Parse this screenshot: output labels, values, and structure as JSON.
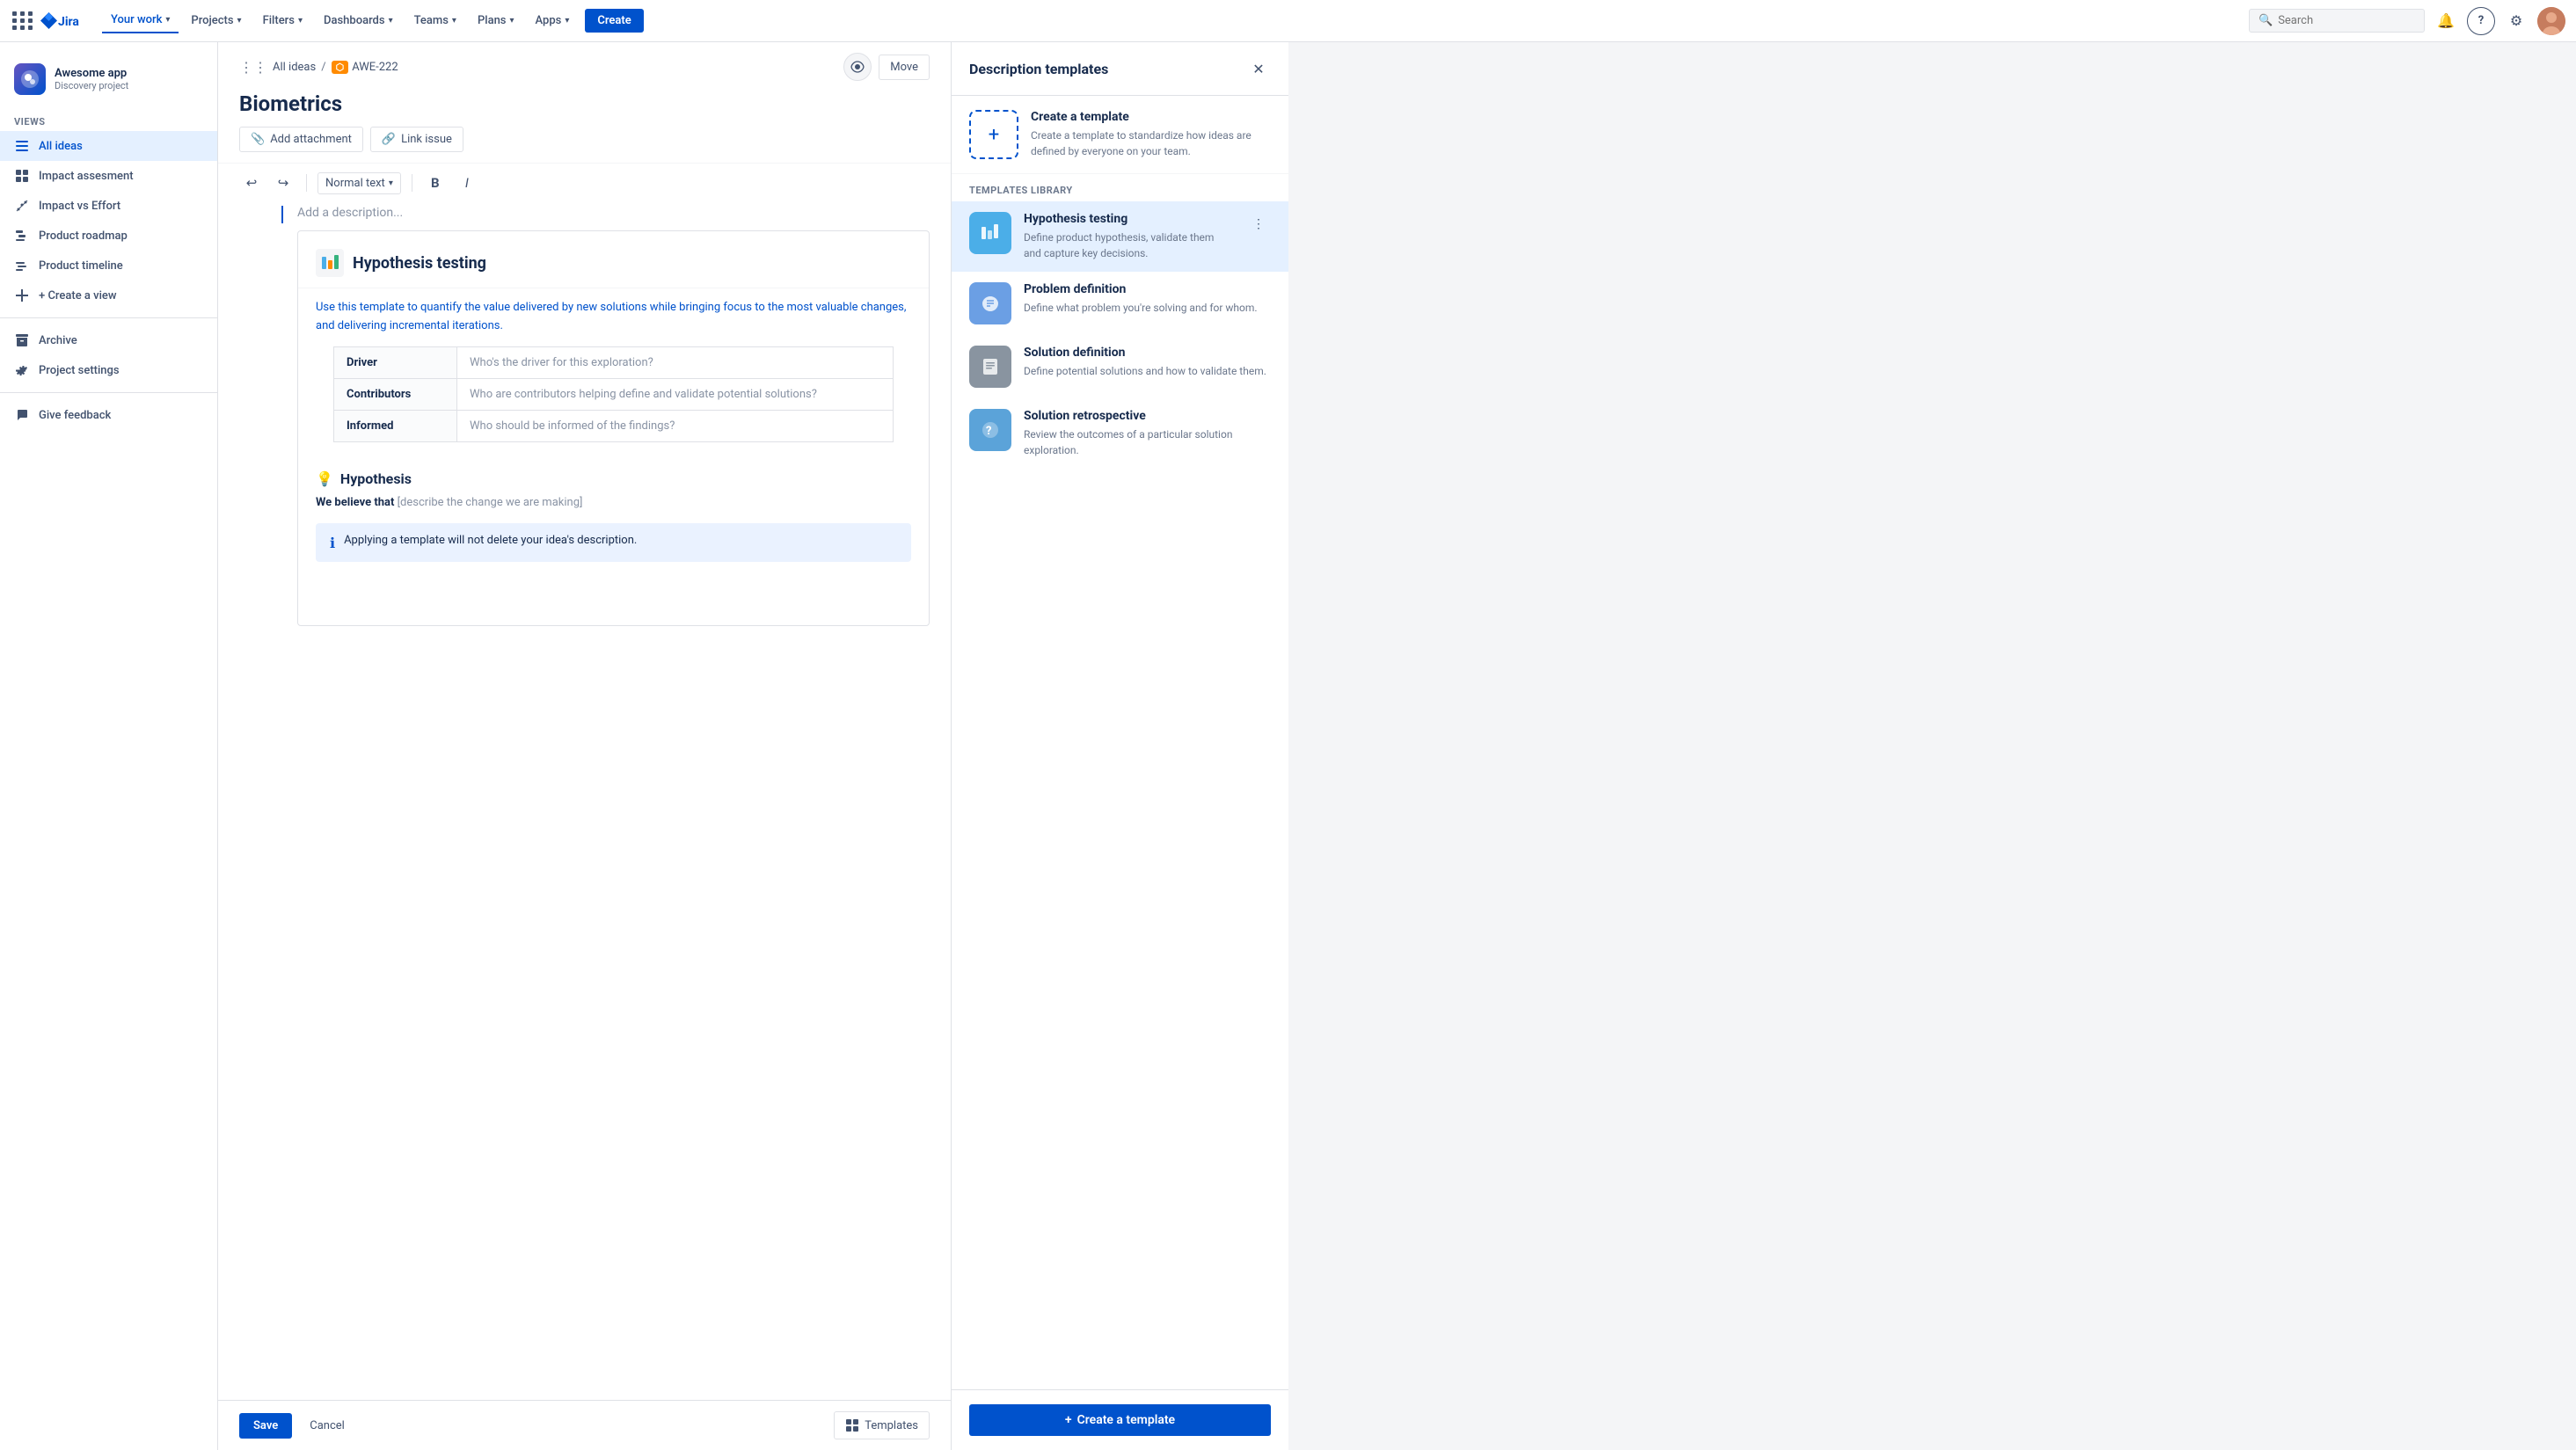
{
  "nav": {
    "your_work": "Your work",
    "projects": "Projects",
    "filters": "Filters",
    "dashboards": "Dashboards",
    "teams": "Teams",
    "plans": "Plans",
    "apps": "Apps",
    "create": "Create",
    "search_placeholder": "Search"
  },
  "sidebar": {
    "project_name": "Awesome app",
    "project_type": "Discovery project",
    "views_label": "VIEWS",
    "add_view": "+ Create a view",
    "items": [
      {
        "id": "all-ideas",
        "label": "All ideas",
        "icon": "list-icon",
        "active": true
      },
      {
        "id": "impact-assessment",
        "label": "Impact assesment",
        "icon": "table-icon"
      },
      {
        "id": "impact-vs-effort",
        "label": "Impact vs Effort",
        "icon": "chart-icon"
      },
      {
        "id": "product-roadmap",
        "label": "Product roadmap",
        "icon": "grid-icon"
      },
      {
        "id": "product-timeline",
        "label": "Product timeline",
        "icon": "timeline-icon"
      }
    ],
    "archive": "Archive",
    "project_settings": "Project settings",
    "give_feedback": "Give feedback"
  },
  "breadcrumb": {
    "all_ideas": "All ideas",
    "issue_id": "AWE-222",
    "watch_label": "Watch",
    "move_label": "Move"
  },
  "issue": {
    "title": "Biometrics",
    "add_attachment": "Add attachment",
    "link_issue": "Link issue",
    "description_placeholder": "Add a description...",
    "text_style": "Normal text"
  },
  "toolbar": {
    "save": "Save",
    "cancel": "Cancel",
    "templates": "Templates"
  },
  "template_preview": {
    "title": "Hypothesis testing",
    "description": "Use this template to quantify the value delivered by new solutions while bringing focus to the most valuable changes, and delivering incremental iterations.",
    "table_rows": [
      {
        "label": "Driver",
        "placeholder": "Who's the driver for this exploration?"
      },
      {
        "label": "Contributors",
        "placeholder": "Who are contributors helping define and validate potential solutions?"
      },
      {
        "label": "Informed",
        "placeholder": "Who should be informed of the findings?"
      }
    ],
    "hypothesis_title": "Hypothesis",
    "hypothesis_text_strong": "We believe that",
    "hypothesis_text_rest": " [describe the change we are making]",
    "notice": "Applying a template will not delete your idea's description."
  },
  "right_panel": {
    "title": "Description templates",
    "create_template_title": "Create a template",
    "create_template_desc": "Create a template to standardize how ideas are defined by everyone on your team.",
    "library_label": "TEMPLATES LIBRARY",
    "templates": [
      {
        "id": "hypothesis-testing",
        "title": "Hypothesis testing",
        "desc": "Define product hypothesis, validate them and capture key decisions.",
        "icon_type": "hypothesis",
        "active": true
      },
      {
        "id": "problem-definition",
        "title": "Problem definition",
        "desc": "Define what problem you're solving and for whom.",
        "icon_type": "problem"
      },
      {
        "id": "solution-definition",
        "title": "Solution definition",
        "desc": "Define potential solutions and how to validate them.",
        "icon_type": "solution-def"
      },
      {
        "id": "solution-retrospective",
        "title": "Solution retrospective",
        "desc": "Review the outcomes of a particular solution exploration.",
        "icon_type": "solution-retro"
      }
    ],
    "create_btn_label": "+ Create a template"
  }
}
